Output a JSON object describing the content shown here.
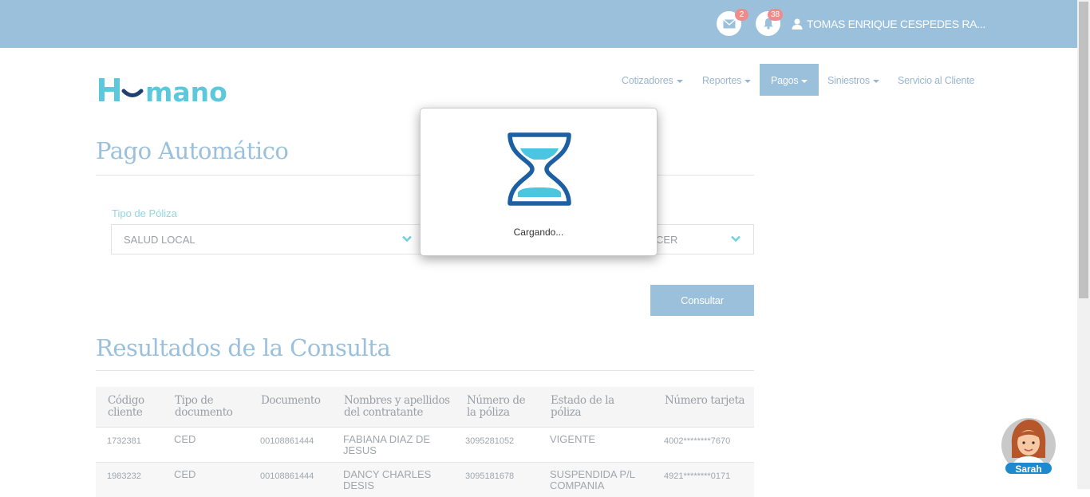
{
  "header": {
    "mail_count": "2",
    "notification_count": "38",
    "user_name": "TOMAS ENRIQUE CESPEDES RA..."
  },
  "nav": {
    "items": [
      {
        "label": "Cotizadores"
      },
      {
        "label": "Reportes"
      },
      {
        "label": "Pagos"
      },
      {
        "label": "Siniestros"
      },
      {
        "label": "Servicio al Cliente"
      }
    ]
  },
  "page": {
    "title": "Pago Automático",
    "policy_type_label": "Tipo de Póliza",
    "policy_type_value": "SALUD LOCAL",
    "second_select_value": "CER",
    "consult_button": "Consultar",
    "results_title": "Resultados de la Consulta"
  },
  "table": {
    "headers": [
      "Código cliente",
      "Tipo de documento",
      "Documento",
      "Nombres y apellidos del contratante",
      "Número de la póliza",
      "Estado de la póliza",
      "Número tarjeta"
    ],
    "header_lines": [
      [
        "Código",
        "cliente"
      ],
      [
        "Tipo de",
        "documento"
      ],
      [
        "Documento",
        ""
      ],
      [
        "Nombres y apellidos",
        "del contratante"
      ],
      [
        "Número de",
        "la póliza"
      ],
      [
        "Estado de la",
        "póliza"
      ],
      [
        "Número tarjeta",
        ""
      ]
    ],
    "rows": [
      {
        "codigo": "1732381",
        "tipo": "CED",
        "documento": "00108861444",
        "nombre_1": "FABIANA DIAZ DE",
        "nombre_2": "JESUS",
        "poliza": "3095281052",
        "estado_1": "VIGENTE",
        "estado_2": "",
        "tarjeta": "4002********7670"
      },
      {
        "codigo": "1983232",
        "tipo": "CED",
        "documento": "00108861444",
        "nombre_1": "DANCY CHARLES",
        "nombre_2": "DESIS",
        "poliza": "3095181678",
        "estado_1": "SUSPENDIDA P/L",
        "estado_2": "COMPANIA",
        "tarjeta": "4921********0171"
      }
    ]
  },
  "modal": {
    "loading_text": "Cargando..."
  },
  "chat": {
    "assistant_name": "Sarah"
  },
  "colors": {
    "brand_blue": "#9ac0dc",
    "brand_teal": "#5cc8dc",
    "badge_red": "#f08b8b",
    "hourglass_blue": "#1d5fa3",
    "hourglass_sand": "#4cc6e0"
  }
}
